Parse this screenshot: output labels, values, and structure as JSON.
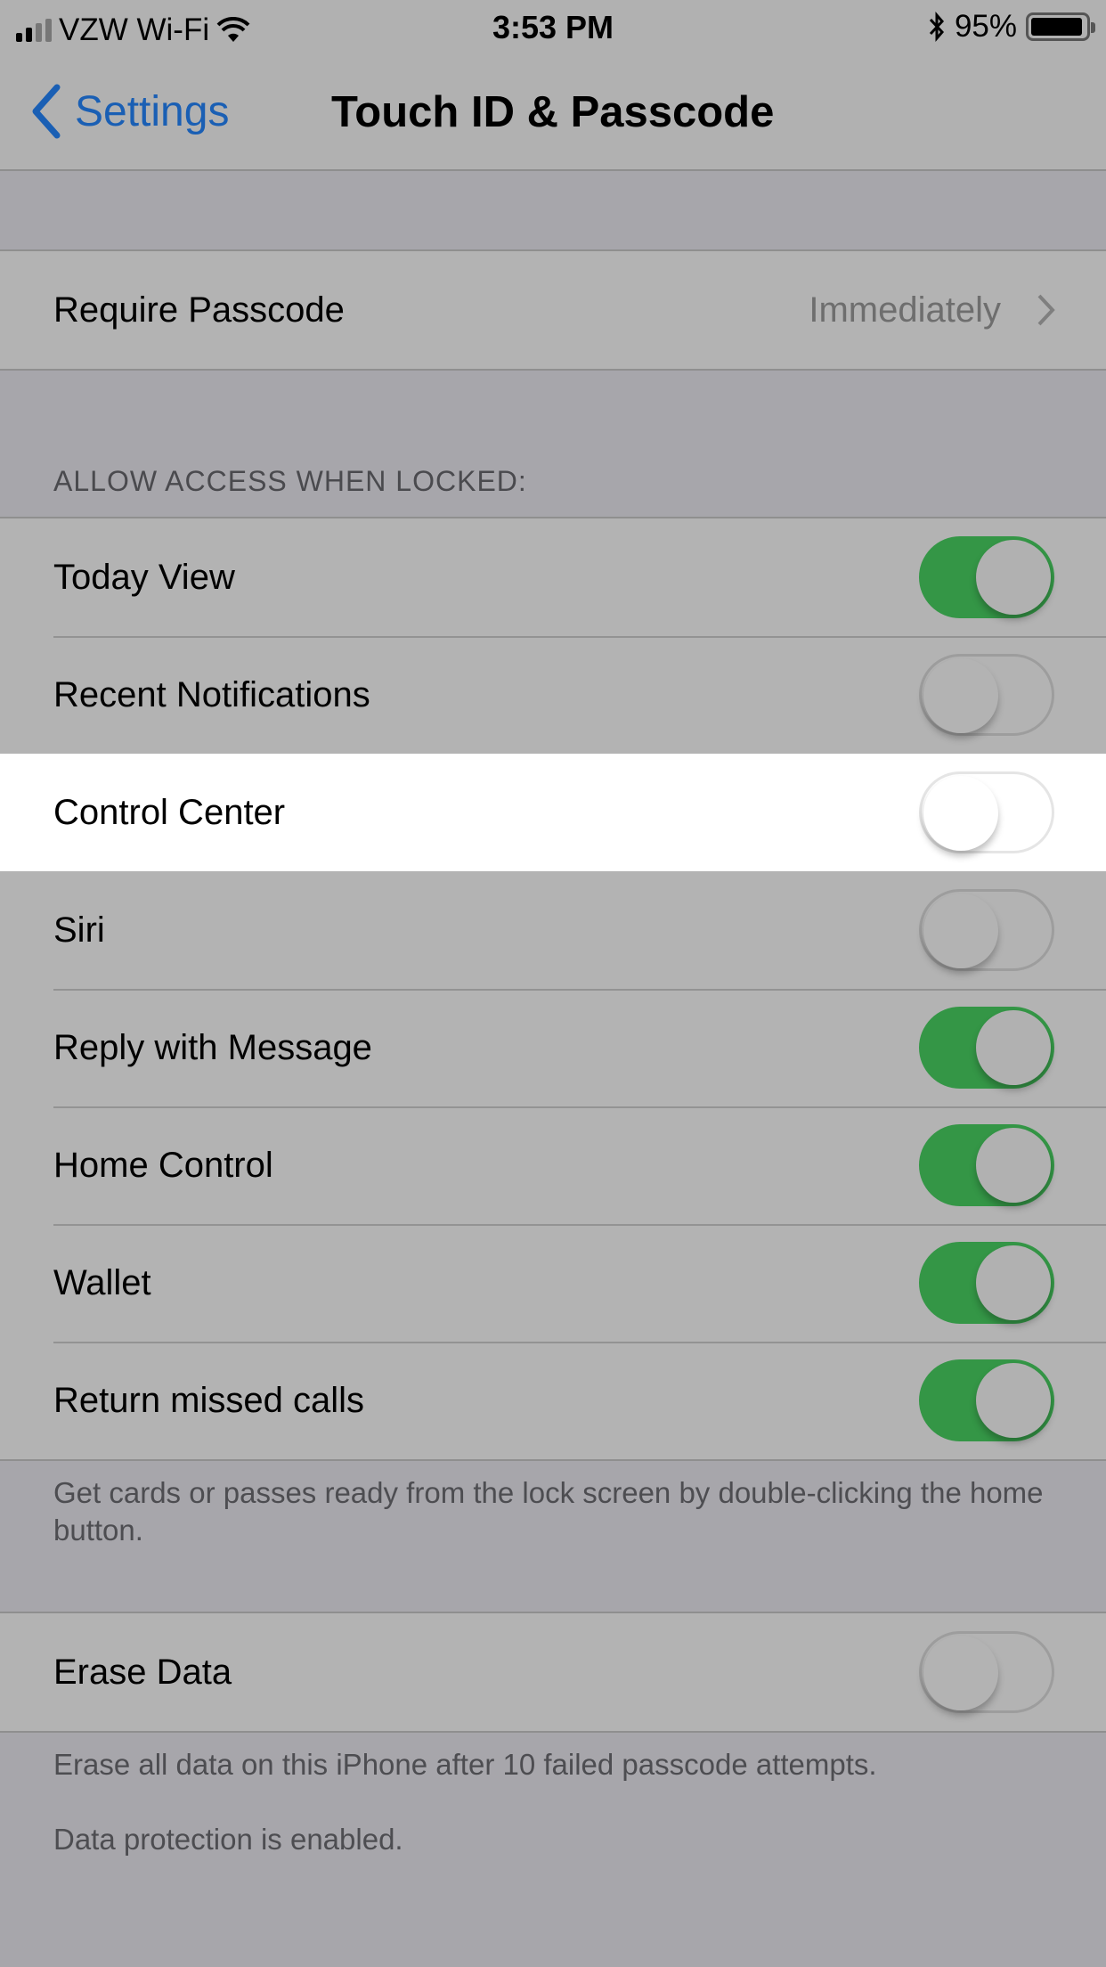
{
  "status_bar": {
    "carrier": "VZW Wi-Fi",
    "time": "3:53 PM",
    "battery_percent": "95%",
    "battery_level": 0.95,
    "signal_bars": 2,
    "signal_bars_total": 4,
    "icons": [
      "signal-icon",
      "wifi-icon",
      "bluetooth-icon",
      "battery-icon"
    ]
  },
  "nav": {
    "back_label": "Settings",
    "title": "Touch ID & Passcode"
  },
  "require_passcode": {
    "label": "Require Passcode",
    "value": "Immediately"
  },
  "locked_section": {
    "header": "ALLOW ACCESS WHEN LOCKED:",
    "items": [
      {
        "label": "Today View",
        "on": true
      },
      {
        "label": "Recent Notifications",
        "on": false
      },
      {
        "label": "Control Center",
        "on": false,
        "highlighted": true
      },
      {
        "label": "Siri",
        "on": false
      },
      {
        "label": "Reply with Message",
        "on": true
      },
      {
        "label": "Home Control",
        "on": true
      },
      {
        "label": "Wallet",
        "on": true
      },
      {
        "label": "Return missed calls",
        "on": true
      }
    ],
    "footer": "Get cards or passes ready from the lock screen by double-clicking the home button."
  },
  "erase_data": {
    "label": "Erase Data",
    "on": false,
    "footer_1": "Erase all data on this iPhone after 10 failed passcode attempts.",
    "footer_2": "Data protection is enabled."
  },
  "colors": {
    "accent": "#1a5fb4",
    "toggle_on": "#349646",
    "background": "#a7a6ab",
    "cell": "#b3b3b3",
    "highlight": "#ffffff"
  }
}
